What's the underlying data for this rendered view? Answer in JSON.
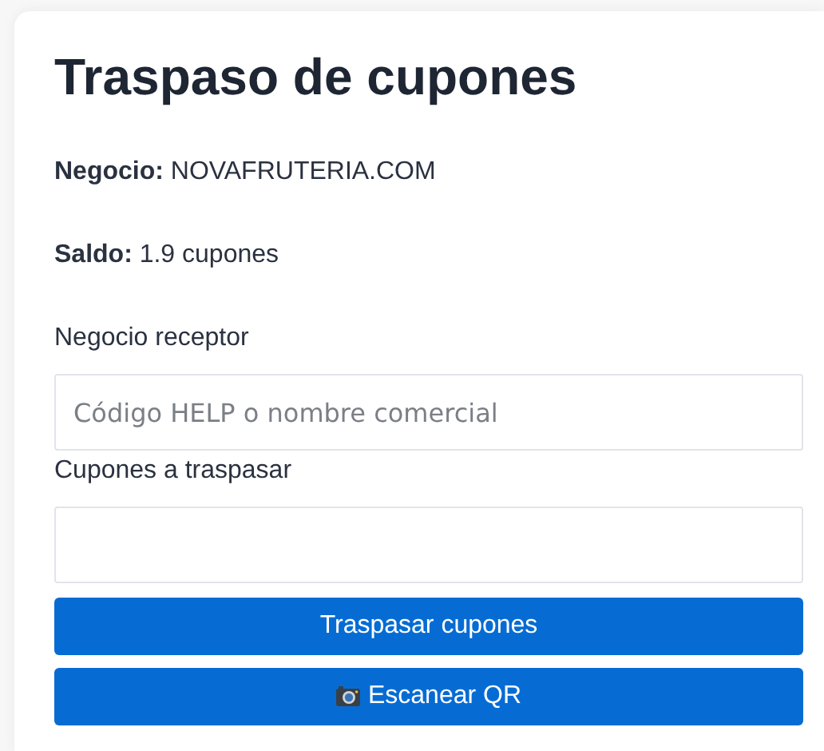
{
  "title": "Traspaso de cupones",
  "info": [
    "**Negocio:** NOVAFRUTERIA.COM",
    "**Saldo:** 1.9 cupones"
  ],
  "fields": [
    {
      "label": "Negocio receptor",
      "placeholder": "Código HELP o nombre comercial"
    },
    {
      "label": "Cupones a traspasar"
    }
  ],
  "buttons": [
    {
      "label": "Traspasar cupones",
      "kind": "plain"
    },
    {
      "label": "Escanear QR",
      "kind": "camera"
    }
  ]
}
